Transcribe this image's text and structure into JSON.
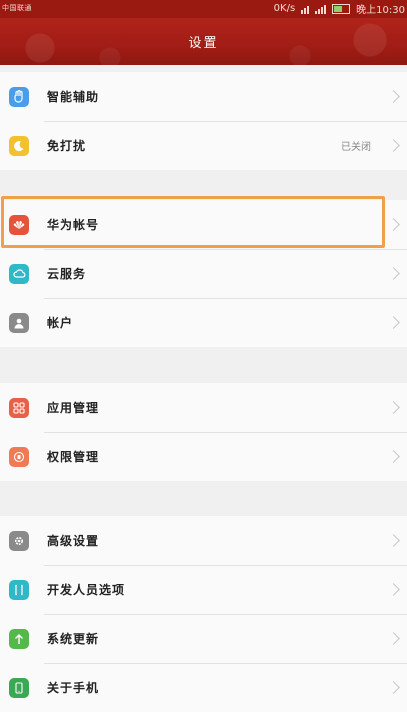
{
  "status_bar": {
    "carrier": "中国联通",
    "speed": "0K/s",
    "time": "晚上10:30"
  },
  "header": {
    "title": "设置"
  },
  "groups": [
    {
      "items": [
        {
          "label": "智能辅助",
          "value": "",
          "icon": "hand-icon",
          "color": "#4a9de8"
        },
        {
          "label": "免打扰",
          "value": "已关闭",
          "icon": "moon-icon",
          "color": "#f2c12e"
        }
      ]
    },
    {
      "items": [
        {
          "label": "华为帐号",
          "value": "",
          "icon": "huawei-logo-icon",
          "color": "#e5533b"
        },
        {
          "label": "云服务",
          "value": "",
          "icon": "cloud-icon",
          "color": "#2fb8c8"
        },
        {
          "label": "帐户",
          "value": "",
          "icon": "person-icon",
          "color": "#8a8a8a"
        }
      ]
    },
    {
      "items": [
        {
          "label": "应用管理",
          "value": "",
          "icon": "apps-grid-icon",
          "color": "#e8604a"
        },
        {
          "label": "权限管理",
          "value": "",
          "icon": "shield-icon",
          "color": "#ef7a55"
        }
      ]
    },
    {
      "items": [
        {
          "label": "高级设置",
          "value": "",
          "icon": "gear-icon",
          "color": "#8a8a8a"
        },
        {
          "label": "开发人员选项",
          "value": "",
          "icon": "braces-icon",
          "color": "#2fb8c8"
        },
        {
          "label": "系统更新",
          "value": "",
          "icon": "arrow-up-icon",
          "color": "#54b84a"
        },
        {
          "label": "关于手机",
          "value": "",
          "icon": "phone-icon",
          "color": "#3aa854"
        }
      ]
    }
  ]
}
